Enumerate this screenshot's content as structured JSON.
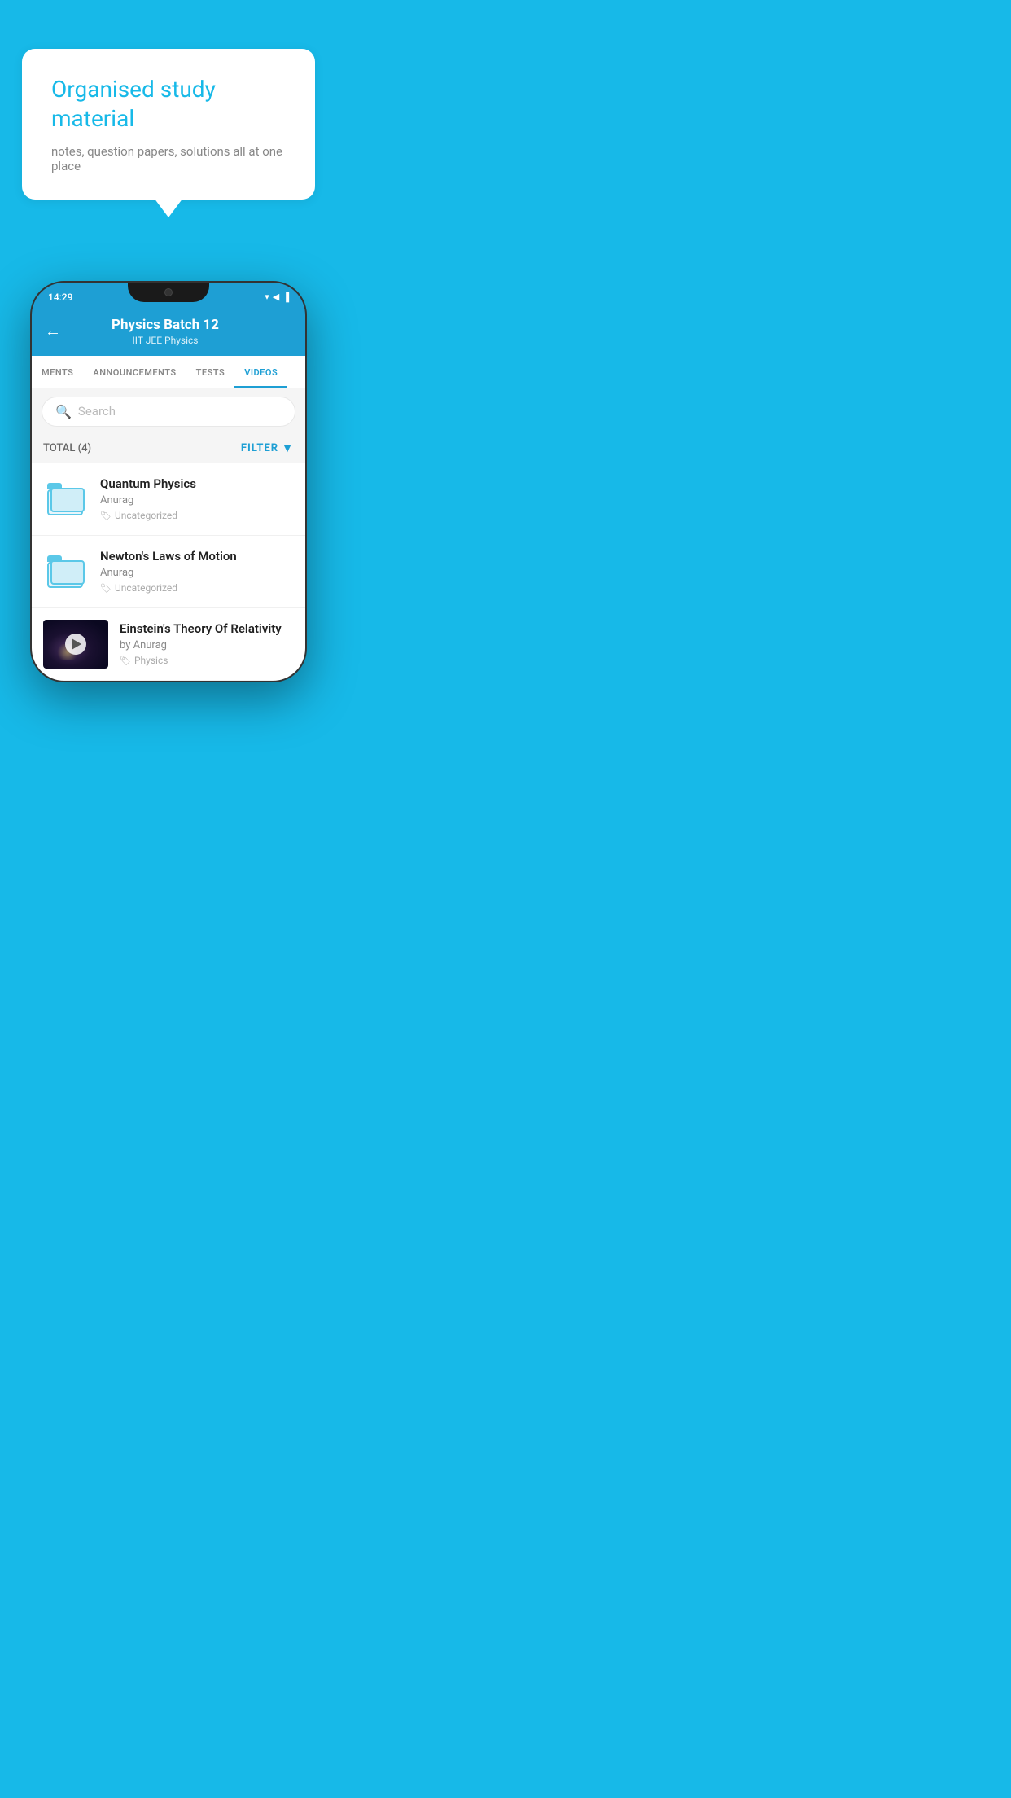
{
  "background_color": "#17b9e8",
  "bubble": {
    "title": "Organised study material",
    "subtitle": "notes, question papers, solutions all at one place"
  },
  "phone": {
    "status_bar": {
      "time": "14:29",
      "icons": "▾◀▐"
    },
    "header": {
      "title": "Physics Batch 12",
      "subtitle": "IIT JEE   Physics",
      "back_label": "←"
    },
    "tabs": [
      {
        "label": "MENTS",
        "active": false
      },
      {
        "label": "ANNOUNCEMENTS",
        "active": false
      },
      {
        "label": "TESTS",
        "active": false
      },
      {
        "label": "VIDEOS",
        "active": true
      }
    ],
    "search": {
      "placeholder": "Search"
    },
    "filter": {
      "total_label": "TOTAL (4)",
      "filter_label": "FILTER"
    },
    "videos": [
      {
        "id": "v1",
        "title": "Quantum Physics",
        "author": "Anurag",
        "tag": "Uncategorized",
        "type": "folder"
      },
      {
        "id": "v2",
        "title": "Newton's Laws of Motion",
        "author": "Anurag",
        "tag": "Uncategorized",
        "type": "folder"
      },
      {
        "id": "v3",
        "title": "Einstein's Theory Of Relativity",
        "author": "by Anurag",
        "tag": "Physics",
        "type": "video"
      }
    ]
  }
}
